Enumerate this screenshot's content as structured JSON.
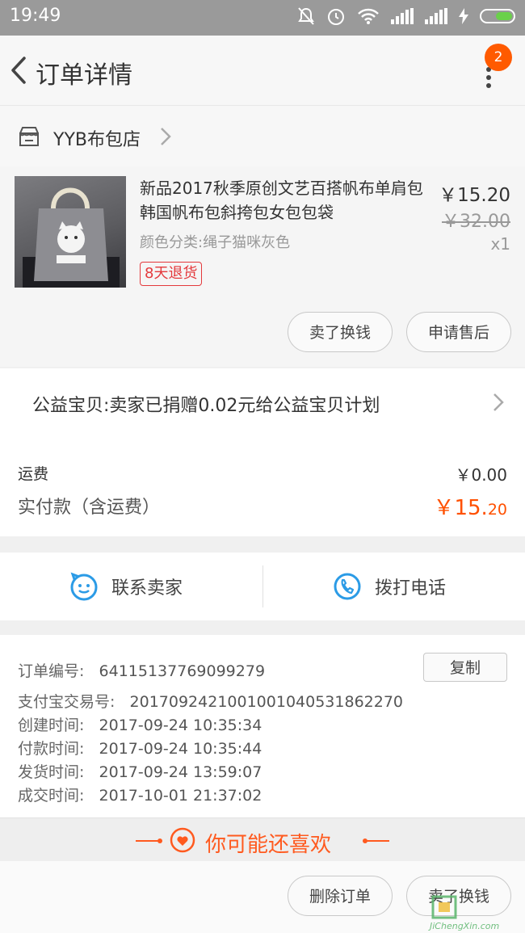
{
  "status_bar": {
    "time": "19:49"
  },
  "header": {
    "title": "订单详情",
    "badge_count": "2"
  },
  "shop": {
    "name": "YYB布包店"
  },
  "product": {
    "title": "新品2017秋季原创文艺百搭帆布单肩包韩国帆布包斜挎包女包包袋",
    "spec": "颜色分类:绳子猫咪灰色",
    "tag": "8天退货",
    "price": "￥15.20",
    "original_price": "￥32.00",
    "quantity": "x1",
    "buttons": {
      "sell": "卖了换钱",
      "after_sale": "申请售后"
    }
  },
  "charity": {
    "text": "公益宝贝:卖家已捐赠0.02元给公益宝贝计划"
  },
  "fees": {
    "shipping_label": "运费",
    "shipping_value": "￥0.00",
    "paid_label": "实付款（含运费）",
    "paid_value_main": "￥15.",
    "paid_value_decimal": "20"
  },
  "contact": {
    "seller": "联系卖家",
    "phone": "拨打电话"
  },
  "order_info": {
    "order_no_label": "订单编号:",
    "order_no": "64115137769099279",
    "copy_button": "复制",
    "alipay_label": "支付宝交易号:",
    "alipay_no": "2017092421001001040531862270",
    "created_label": "创建时间:",
    "created": "2017-09-24 10:35:34",
    "paid_label": "付款时间:",
    "paid": "2017-09-24 10:35:44",
    "shipped_label": "发货时间:",
    "shipped": "2017-09-24 13:59:07",
    "completed_label": "成交时间:",
    "completed": "2017-10-01 21:37:02"
  },
  "recommend": {
    "title": "你可能还喜欢"
  },
  "bottom_bar": {
    "delete": "删除订单",
    "sell": "卖了换钱"
  },
  "watermark": {
    "text": "JiChengXin.com"
  },
  "colors": {
    "accent": "#ff5000",
    "tag_red": "#e4393c",
    "contact_blue": "#2b9be6"
  }
}
